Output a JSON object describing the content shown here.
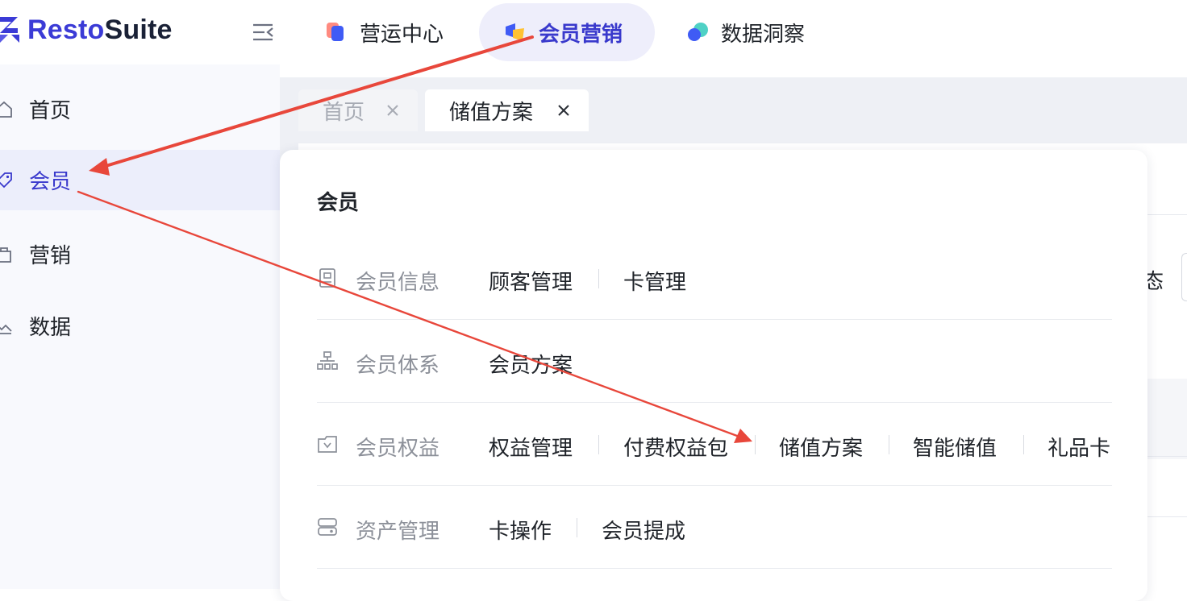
{
  "brand": {
    "name_accent": "Resto",
    "name_rest": "Suite"
  },
  "top_nav": [
    {
      "label": "营运中心",
      "active": false
    },
    {
      "label": "会员营销",
      "active": true
    },
    {
      "label": "数据洞察",
      "active": false
    }
  ],
  "sidebar": [
    {
      "label": "首页",
      "icon": "home-icon",
      "active": false
    },
    {
      "label": "会员",
      "icon": "tag-icon",
      "active": true
    },
    {
      "label": "营销",
      "icon": "gift-bag-icon",
      "active": false
    },
    {
      "label": "数据",
      "icon": "chart-icon",
      "active": false
    }
  ],
  "page_tabs": [
    {
      "label": "首页",
      "active": false
    },
    {
      "label": "储值方案",
      "active": true
    }
  ],
  "background_hint": {
    "status_fragment": "态"
  },
  "menu": {
    "title": "会员",
    "rows": [
      {
        "label": "会员信息",
        "icon": "id-card-icon",
        "links": [
          "顾客管理",
          "卡管理"
        ]
      },
      {
        "label": "会员体系",
        "icon": "hierarchy-icon",
        "links": [
          "会员方案"
        ]
      },
      {
        "label": "会员权益",
        "icon": "benefit-box-icon",
        "links": [
          "权益管理",
          "付费权益包",
          "储值方案",
          "智能储值",
          "礼品卡"
        ]
      },
      {
        "label": "资产管理",
        "icon": "wallet-icon",
        "links": [
          "卡操作",
          "会员提成"
        ]
      }
    ]
  },
  "colors": {
    "accent": "#3939cc",
    "active_bg": "#eceefb",
    "annotation_arrow": "#e8473b"
  }
}
